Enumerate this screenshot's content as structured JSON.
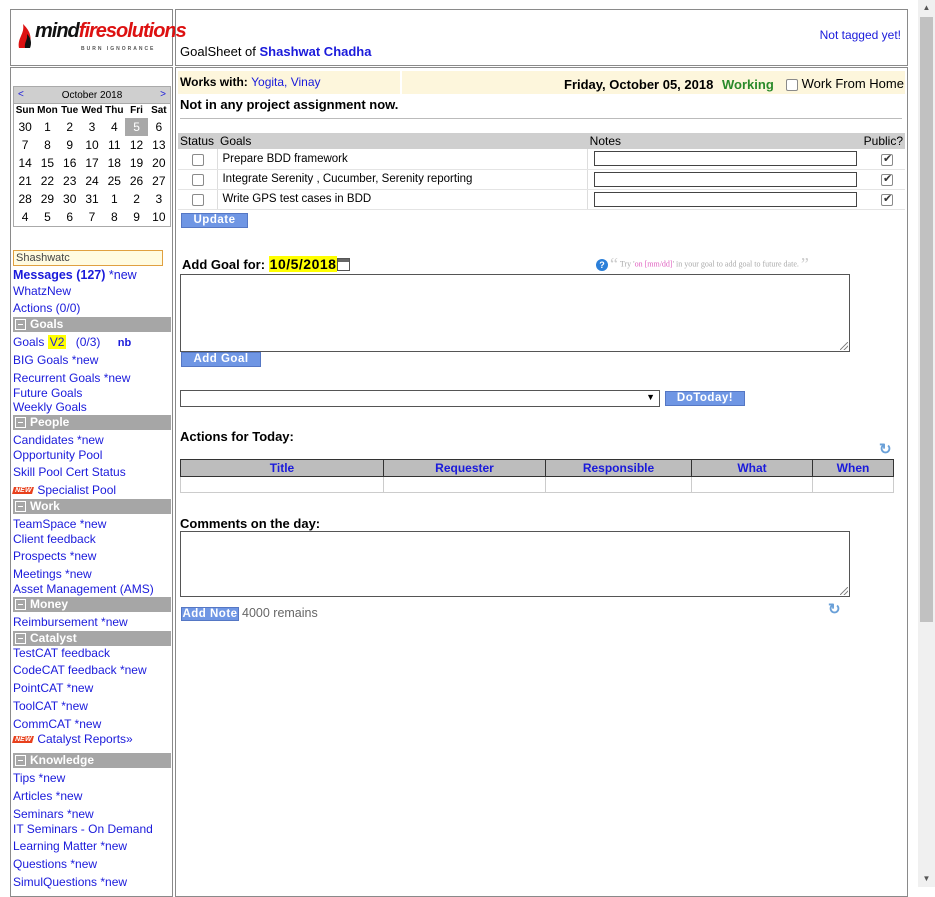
{
  "logo": {
    "brand_prefix": "mind",
    "brand_suffix": "firesolutions",
    "tagline": "BURN IGNORANCE"
  },
  "header": {
    "goalsheet_label": "GoalSheet of",
    "user_name": "Shashwat Chadha",
    "not_tagged": "Not tagged yet!"
  },
  "calendar": {
    "prev": "<",
    "next": ">",
    "month": "October 2018",
    "weekdays": [
      "Sun",
      "Mon",
      "Tue",
      "Wed",
      "Thu",
      "Fri",
      "Sat"
    ],
    "days": [
      "30",
      "1",
      "2",
      "3",
      "4",
      "5",
      "6",
      "7",
      "8",
      "9",
      "10",
      "11",
      "12",
      "13",
      "14",
      "15",
      "16",
      "17",
      "18",
      "19",
      "20",
      "21",
      "22",
      "23",
      "24",
      "25",
      "26",
      "27",
      "28",
      "29",
      "30",
      "31",
      "1",
      "2",
      "3",
      "4",
      "5",
      "6",
      "7",
      "8",
      "9",
      "10"
    ],
    "today_index": 5
  },
  "sidebar": {
    "search_value": "Shashwatc",
    "messages": "Messages (127)",
    "messages_new": " *new",
    "whatznew": "WhatzNew",
    "actions": "Actions (0/0)",
    "sections": {
      "goals": "Goals",
      "people": "People",
      "work": "Work",
      "money": "Money",
      "catalyst": "Catalyst",
      "knowledge": "Knowledge"
    },
    "goals_link": "Goals",
    "goals_v2": "V2",
    "goals_count": "(0/3)",
    "goals_nb": "nb",
    "big_goals": "BIG Goals *new",
    "recurrent_goals": "Recurrent Goals *new",
    "future_goals": "Future Goals",
    "weekly_goals": "Weekly Goals",
    "candidates": "Candidates *new",
    "opportunity_pool": "Opportunity Pool",
    "skill_pool": "Skill Pool Cert Status",
    "new_badge": "NEW",
    "specialist_pool": "Specialist Pool",
    "teamspace": "TeamSpace *new",
    "client_feedback": "Client feedback",
    "prospects": "Prospects *new",
    "meetings": "Meetings *new",
    "asset_management": "Asset Management (AMS)",
    "reimbursement": "Reimbursement *new",
    "testcat": "TestCAT feedback",
    "codecat": "CodeCAT feedback *new",
    "pointcat": "PointCAT *new",
    "toolcat": "ToolCAT *new",
    "commcat": "CommCAT *new",
    "catalyst_reports": "Catalyst Reports»",
    "tips": "Tips *new",
    "articles": "Articles *new",
    "seminars": "Seminars *new",
    "it_seminars": "IT Seminars - On Demand",
    "learning_matter": "Learning Matter *new",
    "questions": "Questions *new",
    "simulquestions": "SimulQuestions *new"
  },
  "main": {
    "works_with_label": "Works with:",
    "works_with_names": "Yogita, Vinay",
    "date": "Friday, October 05, 2018",
    "status": "Working",
    "wfh_label": "Work From Home",
    "no_project": "Not in any project assignment now.",
    "goals_table": {
      "headers": {
        "status": "Status",
        "goals": "Goals",
        "notes": "Notes",
        "public": "Public?"
      },
      "rows": [
        {
          "goal": "Prepare BDD framework",
          "done": false,
          "public": true
        },
        {
          "goal": "Integrate Serenity , Cucumber, Serenity reporting",
          "done": false,
          "public": true
        },
        {
          "goal": "Write GPS test cases in BDD",
          "done": false,
          "public": true
        }
      ]
    },
    "update_button": "Update",
    "add_goal_label": "Add Goal for:",
    "add_goal_date": "10/5/2018",
    "hint_try": "Try '",
    "hint_code": "on [mm/dd]",
    "hint_rest": "' in your goal to add goal to future date.",
    "add_goal_button": "Add Goal",
    "dotoday_button": "DoToday!",
    "actions_title": "Actions for Today:",
    "actions_headers": [
      "Title",
      "Requester",
      "Responsible",
      "What",
      "When"
    ],
    "comments_title": "Comments on the day:",
    "add_note_button": "Add Note",
    "remains": "4000 remains"
  },
  "colors": {
    "link": "#1a1adb",
    "section_bg": "#a6a6a6",
    "button_bg": "#6f96e4",
    "working": "#2a8a2a",
    "highlight": "#ffff00"
  }
}
